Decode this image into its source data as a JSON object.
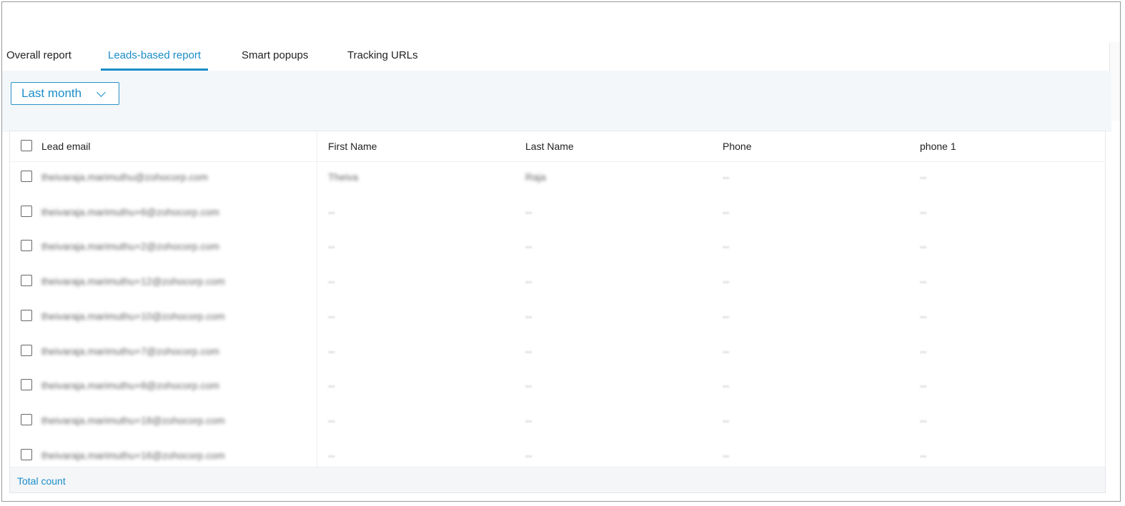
{
  "tabs": [
    {
      "label": "Overall report",
      "active": false
    },
    {
      "label": "Leads-based report",
      "active": true
    },
    {
      "label": "Smart popups",
      "active": false
    },
    {
      "label": "Tracking URLs",
      "active": false
    }
  ],
  "filter": {
    "range_label": "Last month"
  },
  "table": {
    "columns": [
      "Lead email",
      "First Name",
      "Last Name",
      "Phone",
      "phone 1"
    ],
    "rows": [
      {
        "email": "theivaraja.marimuthu@zohocorp.com",
        "first": "Theiva",
        "last": "Raja",
        "phone": "--",
        "phone1": "--"
      },
      {
        "email": "theivaraja.marimuthu+6@zohocorp.com",
        "first": "--",
        "last": "--",
        "phone": "--",
        "phone1": "--"
      },
      {
        "email": "theivaraja.marimuthu+2@zohocorp.com",
        "first": "--",
        "last": "--",
        "phone": "--",
        "phone1": "--"
      },
      {
        "email": "theivaraja.marimuthu+12@zohocorp.com",
        "first": "--",
        "last": "--",
        "phone": "--",
        "phone1": "--"
      },
      {
        "email": "theivaraja.marimuthu+10@zohocorp.com",
        "first": "--",
        "last": "--",
        "phone": "--",
        "phone1": "--"
      },
      {
        "email": "theivaraja.marimuthu+7@zohocorp.com",
        "first": "--",
        "last": "--",
        "phone": "--",
        "phone1": "--"
      },
      {
        "email": "theivaraja.marimuthu+8@zohocorp.com",
        "first": "--",
        "last": "--",
        "phone": "--",
        "phone1": "--"
      },
      {
        "email": "theivaraja.marimuthu+18@zohocorp.com",
        "first": "--",
        "last": "--",
        "phone": "--",
        "phone1": "--"
      },
      {
        "email": "theivaraja.marimuthu+16@zohocorp.com",
        "first": "--",
        "last": "--",
        "phone": "--",
        "phone1": "--"
      }
    ]
  },
  "footer": {
    "total_label": "Total count"
  },
  "colors": {
    "accent": "#1a8dc8",
    "background_band": "#f4f7f9"
  }
}
